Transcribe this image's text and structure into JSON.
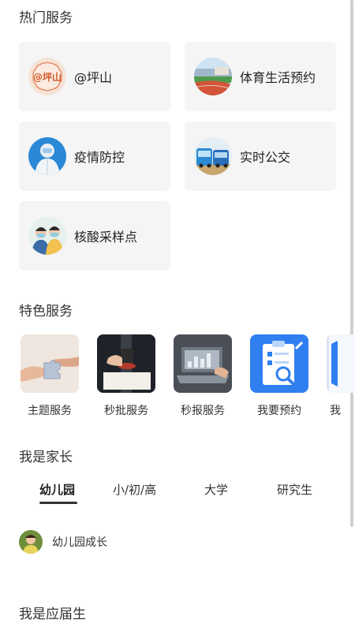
{
  "hot_services": {
    "title": "热门服务",
    "items": [
      {
        "label": "@坪山",
        "icon": "pingshan-logo-icon"
      },
      {
        "label": "体育生活预约",
        "icon": "stadium-icon"
      },
      {
        "label": "疫情防控",
        "icon": "protective-suit-icon"
      },
      {
        "label": "实时公交",
        "icon": "bus-icon"
      },
      {
        "label": "核酸采样点",
        "icon": "nucleic-test-icon"
      }
    ]
  },
  "special_services": {
    "title": "特色服务",
    "items": [
      {
        "label": "主题服务",
        "icon": "puzzle-hands-icon"
      },
      {
        "label": "秒批服务",
        "icon": "stamp-icon"
      },
      {
        "label": "秒报服务",
        "icon": "laptop-chart-icon"
      },
      {
        "label": "我要预约",
        "icon": "clipboard-icon"
      },
      {
        "label": "我",
        "icon": "partial-service-icon"
      }
    ]
  },
  "parent": {
    "title": "我是家长",
    "tabs": [
      {
        "label": "幼儿园",
        "active": true
      },
      {
        "label": "小/初/高",
        "active": false
      },
      {
        "label": "大学",
        "active": false
      },
      {
        "label": "研究生",
        "active": false
      }
    ],
    "item_label": "幼儿园成长"
  },
  "graduate": {
    "title": "我是应届生"
  },
  "logo_text": "@坪山",
  "colors": {
    "card_bg": "#f5f5f5",
    "text": "#222222",
    "accent_blue": "#2f7ff0"
  }
}
